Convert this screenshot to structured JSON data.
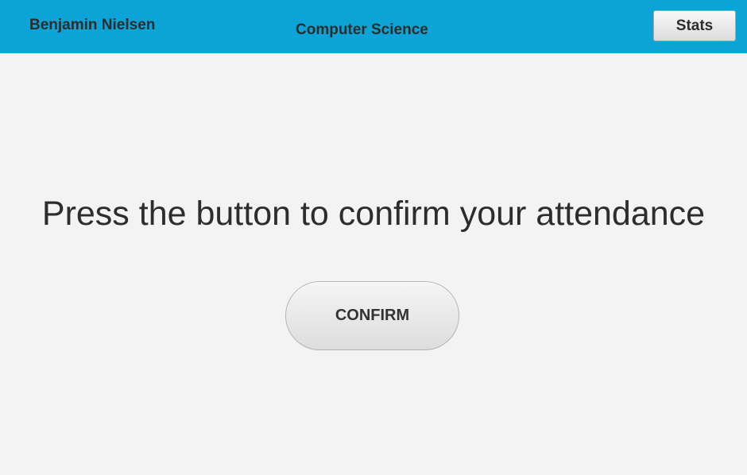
{
  "header": {
    "user_name": "Benjamin Nielsen",
    "course_title": "Computer Science",
    "stats_label": "Stats"
  },
  "main": {
    "prompt": "Press the button to confirm your attendance",
    "confirm_label": "CONFIRM"
  },
  "colors": {
    "header_background": "#0ca4d6",
    "page_background": "#f3f3f3",
    "text": "#2c2c2c"
  }
}
